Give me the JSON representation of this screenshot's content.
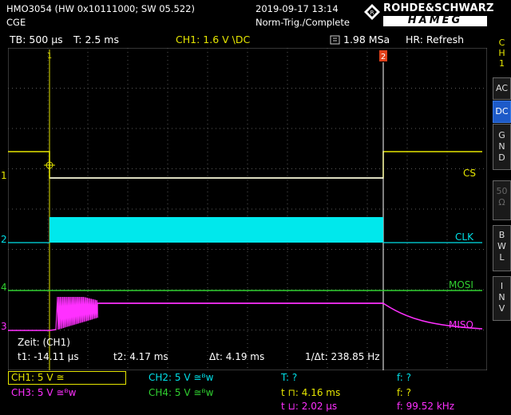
{
  "header": {
    "model": "HMO3054 (HW 0x10111000; SW 05.522)",
    "label": "CGE",
    "datetime": "2019-09-17 13:14",
    "trigger_status": "Norm-Trig./Complete",
    "brand_top": "ROHDE&SCHWARZ",
    "brand_bottom": "HAMEG"
  },
  "topbar": {
    "timebase": "TB: 500 µs",
    "trigger_time": "T: 2.5 ms",
    "trigger_source": "CH1: 1.6 V \\DC",
    "sample_rate": "1.98 MSa",
    "hr_mode": "HR: Refresh"
  },
  "side_menu": {
    "ch_title": "C H 1",
    "ac": "AC",
    "dc": "DC",
    "gnd": "G N D",
    "fifty": "50 Ω",
    "bwl": "B W L",
    "inv": "I N V"
  },
  "channels": {
    "cs": "CS",
    "clk": "CLK",
    "mosi": "MOSI",
    "miso": "MISO",
    "ch_markers": [
      "1",
      "2",
      "3",
      "4"
    ]
  },
  "measurements": {
    "zeit": "Zeit: (CH1)",
    "t1": "t1: -14.11 µs",
    "t2": "t2: 4.17 ms",
    "dt": "Δt: 4.19 ms",
    "inv_dt": "1/Δt: 238.85 Hz"
  },
  "footer": {
    "ch1": "CH1: 5 V ≅",
    "ch2": "CH2: 5 V ≅ᴮᴡ",
    "ch3": "CH3: 5 V ≅ᴮᴡ",
    "ch4": "CH4: 5 V ≅ᴮᴡ",
    "period_label": "T: ?",
    "freq_label_1": "f: ?",
    "pos_width": "t ⊓: 4.16 ms",
    "freq_label_2": "f: ?",
    "neg_width": "t ⊔: 2.02 µs",
    "freq_value": "f: 99.52 kHz"
  },
  "colors": {
    "ch1": "#e6e600",
    "ch2": "#00e0e8",
    "ch3": "#ff30ff",
    "ch4": "#30d030",
    "grid": "#5a5a5a"
  }
}
